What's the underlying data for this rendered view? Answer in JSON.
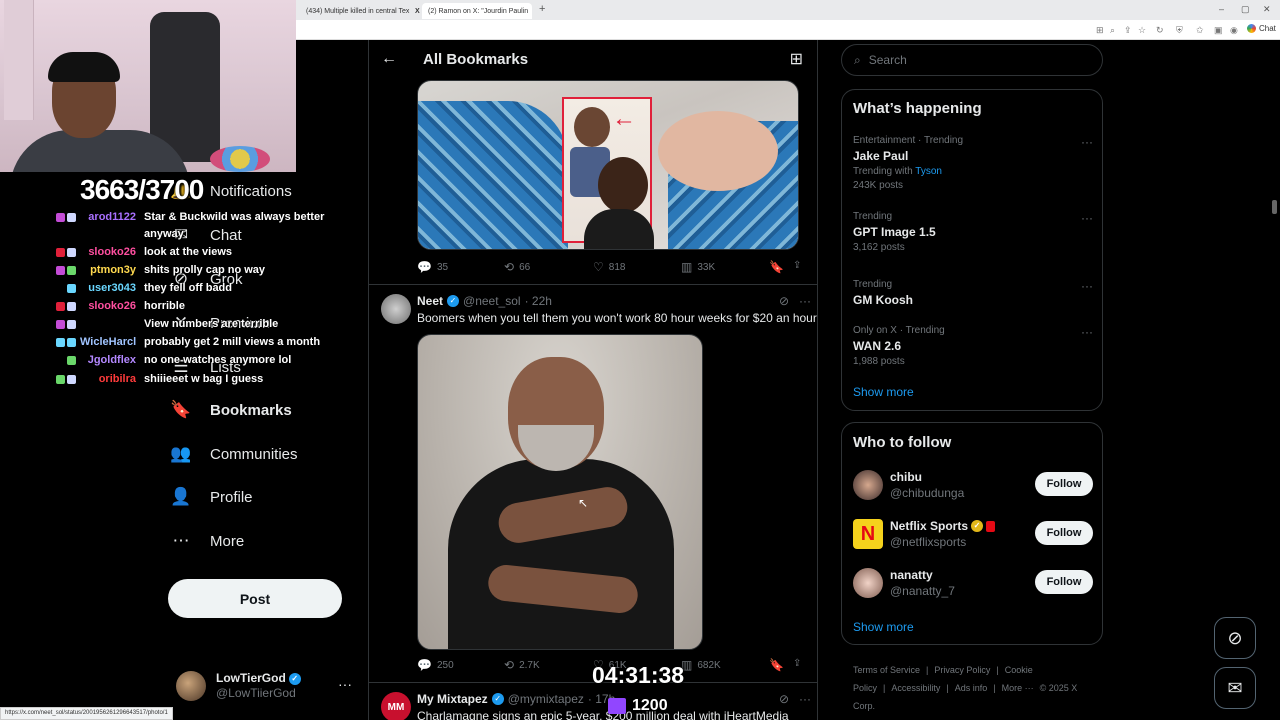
{
  "browser": {
    "tabs": [
      {
        "label": "(434) Multiple killed in central Tex",
        "fav_color": "#e02020"
      },
      {
        "label": "X",
        "fav_color": "#000000"
      },
      {
        "label": "(2) Ramon on X: \"Jourdin Paulin",
        "fav_color": "#000000"
      }
    ],
    "new_tab": "+",
    "chat_ext_label": "Chat",
    "status_url": "https://x.com/neet_sol/status/2001956261296643517/photo/1"
  },
  "stream": {
    "viewers": "3663/3700",
    "timer": "04:31:38",
    "sub_count": "1200",
    "chat": [
      {
        "user": "arod1122",
        "color": "#a970ff",
        "text": "Star & Buckwild was always better",
        "badges": [
          "#c34cd6",
          "#cfd8ff"
        ]
      },
      {
        "user": "",
        "color": "#ffffff",
        "text": "anyway",
        "badges": []
      },
      {
        "user": "slooko26",
        "color": "#ff4fa0",
        "text": "look at the views",
        "badges": [
          "#e0203a",
          "#cfd8ff"
        ]
      },
      {
        "user": "ptmon3y",
        "color": "#ffd94f",
        "text": "shits prolly cap no way",
        "badges": [
          "#c34cd6",
          "#6ad76a"
        ]
      },
      {
        "user": "user3043",
        "color": "#6ad7ff",
        "text": "they fell off badd",
        "badges": [
          "#6ad7ff"
        ]
      },
      {
        "user": "slooko26",
        "color": "#ff4fa0",
        "text": "horrible",
        "badges": [
          "#e0203a",
          "#cfd8ff"
        ]
      },
      {
        "user": "",
        "color": "#3a3aff",
        "text": "View numbers are terrible",
        "badges": [
          "#c34cd6",
          "#cfd8ff"
        ]
      },
      {
        "user": "WicleHarcl",
        "color": "#a0c4ff",
        "text": "probably get 2 mill views a month",
        "badges": [
          "#6ad7ff",
          "#6ad7ff"
        ]
      },
      {
        "user": "Jgoldflex",
        "color": "#b388ff",
        "text": "no one watches anymore lol",
        "badges": [
          "#6ad76a"
        ]
      },
      {
        "user": "oribilra",
        "color": "#ff3b3b",
        "text": "shiiieeet w bag I guess",
        "badges": [
          "#6ad76a",
          "#cfd8ff"
        ]
      }
    ]
  },
  "sidebar": {
    "items": [
      {
        "label": "Notifications",
        "icon": "bell-icon",
        "glyph": "🔔"
      },
      {
        "label": "Chat",
        "icon": "mail-icon",
        "glyph": "✉"
      },
      {
        "label": "Grok",
        "icon": "grok-icon",
        "glyph": "⊘"
      },
      {
        "label": "Premium",
        "icon": "x-icon",
        "glyph": "✕"
      },
      {
        "label": "Lists",
        "icon": "list-icon",
        "glyph": "☰"
      },
      {
        "label": "Bookmarks",
        "icon": "bookmark-icon",
        "glyph": "🔖"
      },
      {
        "label": "Communities",
        "icon": "communities-icon",
        "glyph": "👥"
      },
      {
        "label": "Profile",
        "icon": "person-icon",
        "glyph": "👤"
      },
      {
        "label": "More",
        "icon": "more-circle-icon",
        "glyph": "⋯"
      }
    ],
    "post_label": "Post",
    "account": {
      "name": "LowTierGod",
      "handle": "@LowTiierGod"
    }
  },
  "main": {
    "title": "All Bookmarks",
    "tweets": [
      {
        "replies": "35",
        "reposts": "66",
        "likes": "818",
        "views": "33K"
      },
      {
        "name": "Neet",
        "handle": "@neet_sol",
        "time": "· 22h",
        "text": "Boomers when you tell them you won't work 80 hour weeks for $20 an hour",
        "replies": "250",
        "reposts": "2.7K",
        "likes": "61K",
        "views": "682K"
      },
      {
        "name": "My Mixtapez",
        "handle": "@mymixtapez",
        "time": "· 17h",
        "text": "Charlamagne signs an epic 5-year, $200 million deal with iHeartMedia"
      }
    ]
  },
  "right": {
    "search_placeholder": "Search",
    "happening_title": "What’s happening",
    "trends": [
      {
        "meta": "Entertainment · Trending",
        "name": "Jake Paul",
        "sub_prefix": "Trending with ",
        "sub_link": "Tyson",
        "posts": "243K posts"
      },
      {
        "meta": "Trending",
        "name": "GPT Image 1.5",
        "sub_prefix": "",
        "sub_link": "",
        "posts": "3,162 posts"
      },
      {
        "meta": "Trending",
        "name": "GM Koosh",
        "sub_prefix": "",
        "sub_link": "",
        "posts": ""
      },
      {
        "meta": "Only on X · Trending",
        "name": "WAN 2.6",
        "sub_prefix": "",
        "sub_link": "",
        "posts": "1,988 posts"
      }
    ],
    "show_more": "Show more",
    "who_title": "Who to follow",
    "follow": [
      {
        "name": "chibu",
        "handle": "@chibudunga",
        "btn": "Follow"
      },
      {
        "name": "Netflix Sports",
        "handle": "@netflixsports",
        "btn": "Follow"
      },
      {
        "name": "nanatty",
        "handle": "@nanatty_7",
        "btn": "Follow"
      }
    ],
    "footer": [
      "Terms of Service",
      "|",
      "Privacy Policy",
      "|",
      "Cookie Policy",
      "|",
      "Accessibility",
      "|",
      "Ads info",
      "|",
      "More ···",
      "© 2025 X Corp."
    ]
  },
  "colors": {
    "accent": "#1d9bf0",
    "background": "#000000",
    "border": "#2f3336"
  }
}
